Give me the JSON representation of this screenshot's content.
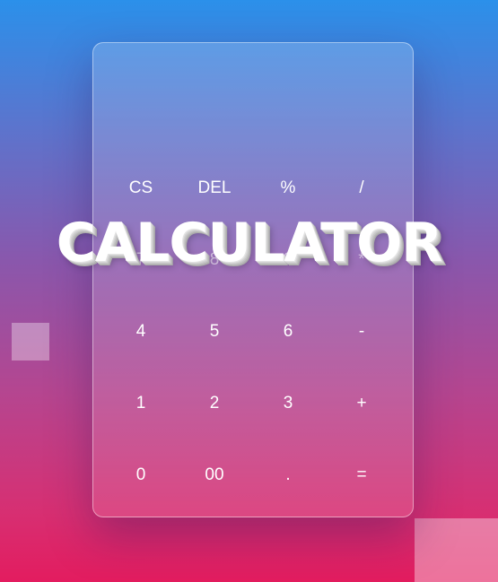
{
  "title": "CALCULATOR",
  "display": {
    "value": ""
  },
  "keys": [
    {
      "label": "CS",
      "name": "clear-button"
    },
    {
      "label": "DEL",
      "name": "delete-button"
    },
    {
      "label": "%",
      "name": "percent-button"
    },
    {
      "label": "/",
      "name": "divide-button"
    },
    {
      "label": "7",
      "name": "digit-7-button"
    },
    {
      "label": "8",
      "name": "digit-8-button"
    },
    {
      "label": "9",
      "name": "digit-9-button"
    },
    {
      "label": "*",
      "name": "multiply-button"
    },
    {
      "label": "4",
      "name": "digit-4-button"
    },
    {
      "label": "5",
      "name": "digit-5-button"
    },
    {
      "label": "6",
      "name": "digit-6-button"
    },
    {
      "label": "-",
      "name": "subtract-button"
    },
    {
      "label": "1",
      "name": "digit-1-button"
    },
    {
      "label": "2",
      "name": "digit-2-button"
    },
    {
      "label": "3",
      "name": "digit-3-button"
    },
    {
      "label": "+",
      "name": "add-button"
    },
    {
      "label": "0",
      "name": "digit-0-button"
    },
    {
      "label": "00",
      "name": "double-zero-button"
    },
    {
      "label": ".",
      "name": "decimal-button"
    },
    {
      "label": "=",
      "name": "equals-button"
    }
  ]
}
